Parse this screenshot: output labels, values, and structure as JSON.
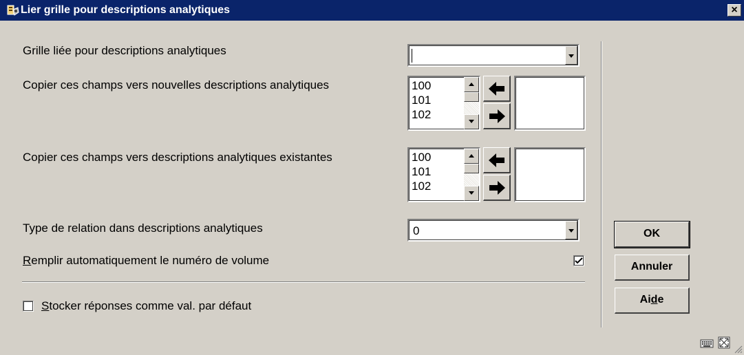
{
  "window": {
    "title": "Lier grille pour descriptions analytiques",
    "close_label": "×"
  },
  "form": {
    "linked_grid": {
      "label": "Grille liée pour descriptions analytiques",
      "value": ""
    },
    "copy_new": {
      "label": "Copier ces champs vers nouvelles descriptions analytiques",
      "items": [
        "100",
        "101",
        "102"
      ],
      "selected": []
    },
    "copy_existing": {
      "label": "Copier ces champs vers descriptions analytiques existantes",
      "items": [
        "100",
        "101",
        "102"
      ],
      "selected": []
    },
    "relation_type": {
      "label": "Type de relation dans descriptions analytiques",
      "value": "0"
    },
    "auto_volume": {
      "label_accel": "R",
      "label_rest": "emplir automatiquement le numéro de volume",
      "checked": true
    },
    "store_defaults": {
      "label_accel": "S",
      "label_rest": "tocker réponses comme val. par défaut",
      "checked": false
    }
  },
  "buttons": {
    "ok": "OK",
    "cancel": "Annuler",
    "help_pre": "Ai",
    "help_accel": "d",
    "help_post": "e"
  },
  "icons": {
    "title": "app-icon",
    "add": "arrow-right-icon",
    "remove": "arrow-left-icon",
    "status": [
      "keyboard-icon",
      "resize-icon"
    ]
  },
  "colors": {
    "titlebar": "#0a246a",
    "face": "#d4d0c8"
  }
}
